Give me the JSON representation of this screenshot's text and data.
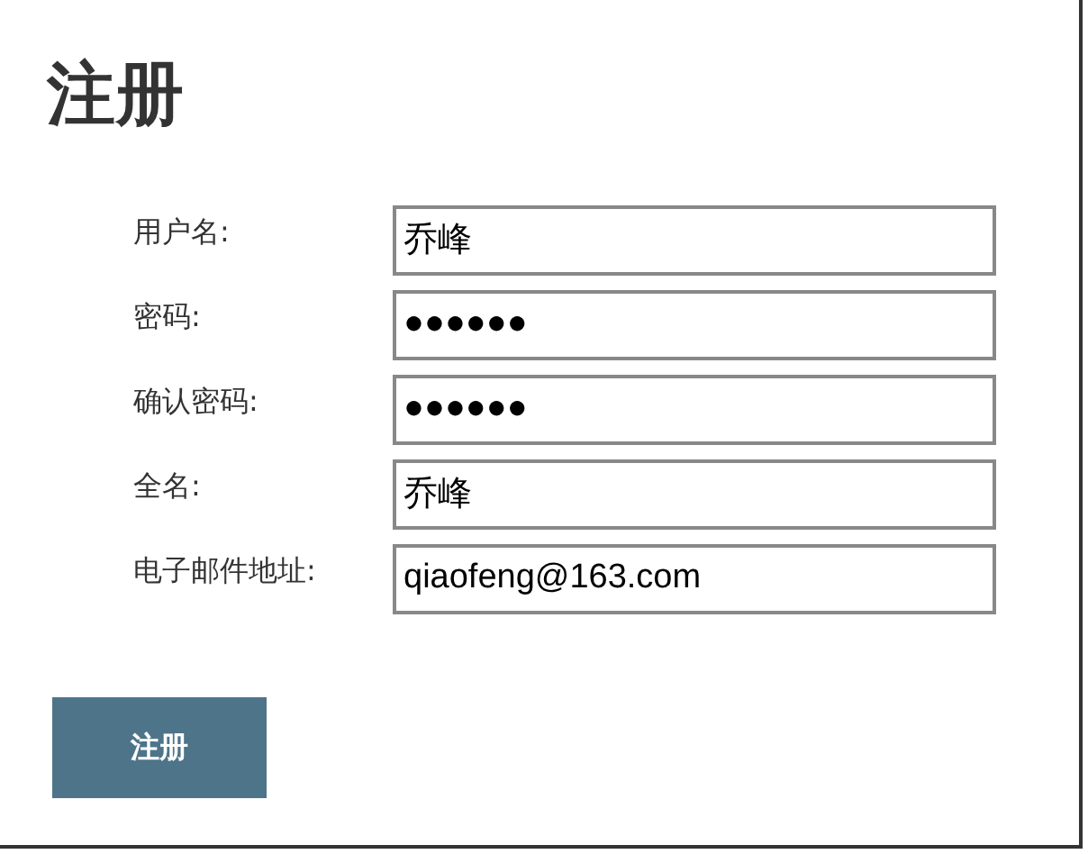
{
  "title": "注册",
  "fields": [
    {
      "label": "用户名:",
      "value": "乔峰"
    },
    {
      "label": "密码:",
      "value": "●●●●●●"
    },
    {
      "label": "确认密码:",
      "value": "●●●●●●"
    },
    {
      "label": "全名:",
      "value": "乔峰"
    },
    {
      "label": "电子邮件地址:",
      "value": "qiaofeng@163.com"
    }
  ],
  "submit_button": "注册"
}
